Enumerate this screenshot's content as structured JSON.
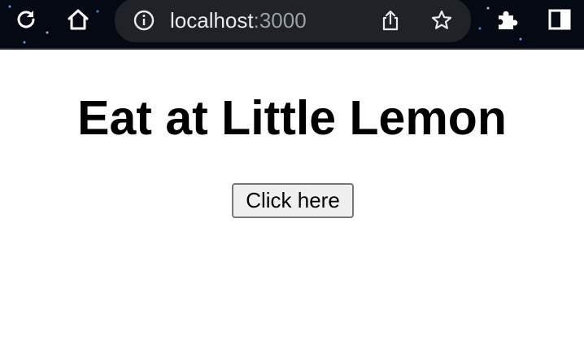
{
  "browser": {
    "url_host": "localhost",
    "url_port": ":3000",
    "icons": [
      "reload-icon",
      "home-icon",
      "info-icon",
      "share-icon",
      "star-icon",
      "extensions-icon",
      "side-panel-icon"
    ]
  },
  "page": {
    "heading": "Eat at Little Lemon",
    "button_label": "Click here"
  },
  "colors": {
    "toolbar_bg": "#050914",
    "omnibox_bg": "#1f2226",
    "url_text": "#e8eaed",
    "url_dim": "#9aa0a6",
    "page_bg": "#ffffff",
    "button_bg": "#efefef",
    "button_border": "#767676"
  }
}
